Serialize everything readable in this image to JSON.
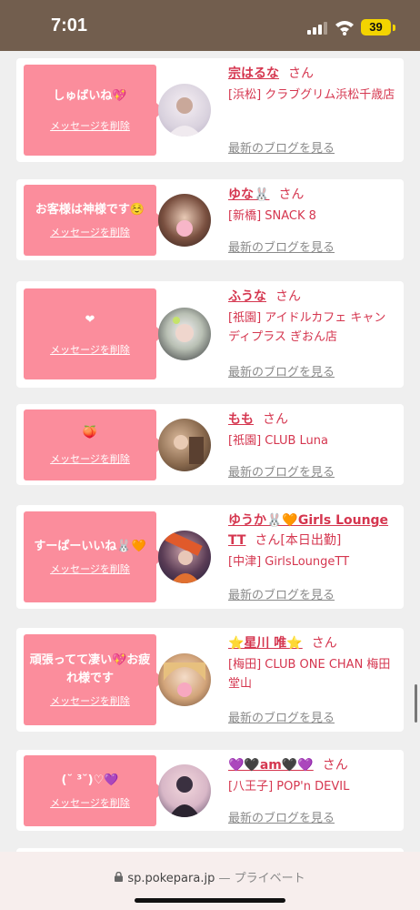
{
  "status_bar": {
    "time": "7:01",
    "battery": "39"
  },
  "cards": [
    {
      "message": "しゅばいね💖",
      "delete_label": "メッセージを削除",
      "name": "宗はるな",
      "honorific": "さん",
      "extra": "",
      "shop": "[浜松] クラブグリム浜松千歳店",
      "blog_label": "最新のブログを見る"
    },
    {
      "message": "お客様は神様です☺️",
      "delete_label": "メッセージを削除",
      "name": "ゆな🐰",
      "honorific": "さん",
      "extra": "",
      "shop": "[新橋] SNACK 8",
      "blog_label": "最新のブログを見る"
    },
    {
      "message": "❤",
      "delete_label": "メッセージを削除",
      "name": "ふうな",
      "honorific": "さん",
      "extra": "",
      "shop": "[祇園] アイドルカフェ キャンディプラス ぎおん店",
      "blog_label": "最新のブログを見る"
    },
    {
      "message": "🍑",
      "delete_label": "メッセージを削除",
      "name": "もも",
      "honorific": "さん",
      "extra": "",
      "shop": "[祇園] CLUB Luna",
      "blog_label": "最新のブログを見る"
    },
    {
      "message": "すーぱーいいね🐰🧡",
      "delete_label": "メッセージを削除",
      "name": "ゆうか🐰🧡Girls Lounge TT",
      "honorific": "さん",
      "extra": "[本日出勤]",
      "shop": "[中津] GirlsLoungeTT",
      "blog_label": "最新のブログを見る"
    },
    {
      "message": "頑張ってて凄い💖お疲れ様です",
      "delete_label": "メッセージを削除",
      "name": "⭐星川 唯⭐",
      "honorific": "さん",
      "extra": "",
      "shop": "[梅田] CLUB ONE CHAN 梅田堂山",
      "blog_label": "最新のブログを見る"
    },
    {
      "message": "(˘ ³˘)♡💜",
      "delete_label": "メッセージを削除",
      "name": "💜🖤am🖤💜",
      "honorific": "さん",
      "extra": "",
      "shop": "[八王子] POP'n DEVIL",
      "blog_label": "最新のブログを見る"
    }
  ],
  "browser": {
    "domain": "sp.pokepara.jp",
    "mode": "— プライベート"
  },
  "colors": {
    "status_bar": "#725e4e",
    "bubble": "#fb8d9c",
    "accent": "#d5364f",
    "battery": "#f3d400"
  }
}
